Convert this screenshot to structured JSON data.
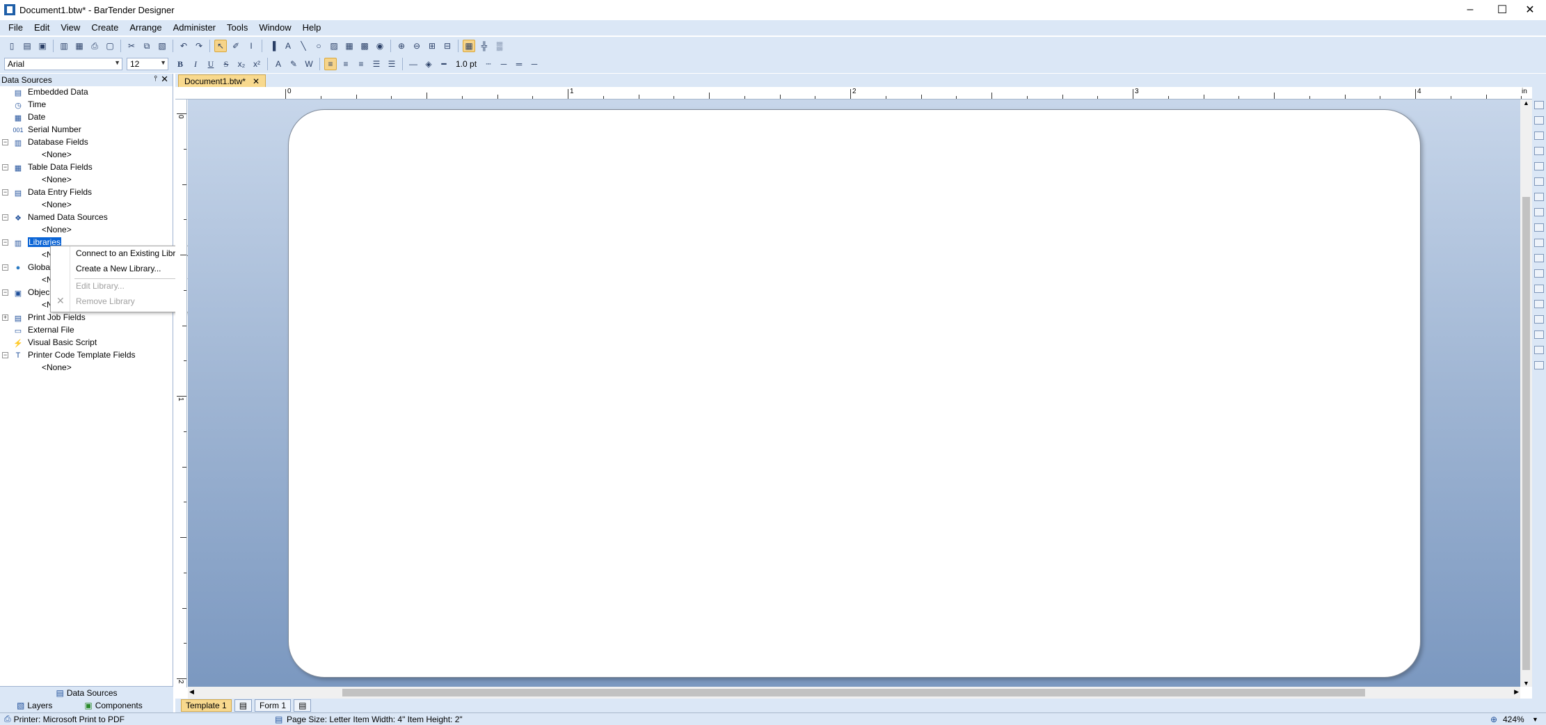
{
  "window": {
    "title": "Document1.btw* - BarTender Designer",
    "controls": [
      "minimize",
      "maximize",
      "close"
    ]
  },
  "menubar": [
    "File",
    "Edit",
    "View",
    "Create",
    "Arrange",
    "Administer",
    "Tools",
    "Window",
    "Help"
  ],
  "format_toolbar": {
    "font": "Arial",
    "size": "12",
    "bold": "B",
    "italic": "I",
    "underline": "U",
    "strike": "S",
    "subscript": "x₂",
    "superscript": "x²",
    "line_width": "1.0 pt"
  },
  "data_sources_panel": {
    "title": "Data Sources",
    "items": [
      {
        "label": "Embedded Data",
        "icon": "embedded-data-icon",
        "glyph": "▤",
        "expander": ""
      },
      {
        "label": "Time",
        "icon": "clock-icon",
        "glyph": "◷",
        "expander": ""
      },
      {
        "label": "Date",
        "icon": "calendar-icon",
        "glyph": "▦",
        "expander": ""
      },
      {
        "label": "Serial Number",
        "icon": "serial-number-icon",
        "glyph": "001",
        "expander": ""
      },
      {
        "label": "Database Fields",
        "icon": "database-icon",
        "glyph": "▥",
        "expander": "−",
        "child": "<None>"
      },
      {
        "label": "Table Data Fields",
        "icon": "table-icon",
        "glyph": "▦",
        "expander": "−",
        "child": "<None>"
      },
      {
        "label": "Data Entry Fields",
        "icon": "form-icon",
        "glyph": "▤",
        "expander": "−",
        "child": "<None>"
      },
      {
        "label": "Named Data Sources",
        "icon": "named-data-icon",
        "glyph": "❖",
        "expander": "−",
        "child": "<None>"
      },
      {
        "label": "Libraries",
        "icon": "library-icon",
        "glyph": "▥",
        "expander": "−",
        "child": "<N",
        "selected": true
      },
      {
        "label": "Globa",
        "icon": "globe-icon",
        "glyph": "●",
        "expander": "−",
        "child": "<N"
      },
      {
        "label": "Objec",
        "icon": "object-icon",
        "glyph": "▣",
        "expander": "−",
        "child": "<N"
      },
      {
        "label": "Print Job Fields",
        "icon": "print-job-icon",
        "glyph": "▤",
        "expander": "+"
      },
      {
        "label": "External File",
        "icon": "external-file-icon",
        "glyph": "▭",
        "expander": ""
      },
      {
        "label": "Visual Basic Script",
        "icon": "script-icon",
        "glyph": "⚡",
        "expander": ""
      },
      {
        "label": "Printer Code Template Fields",
        "icon": "template-field-icon",
        "glyph": "T",
        "expander": "−",
        "child": "<None>"
      }
    ],
    "bottom_tab": "Data Sources",
    "bottom_tabs": [
      "Layers",
      "Components"
    ]
  },
  "context_menu": {
    "items": [
      {
        "label": "Connect to an Existing Library...",
        "enabled": true
      },
      {
        "label": "Create a New Library...",
        "enabled": true
      },
      {
        "label": "Edit Library...",
        "enabled": false
      },
      {
        "label": "Remove Library",
        "enabled": false
      }
    ]
  },
  "document": {
    "tab_label": "Document1.btw*",
    "ruler_h": [
      "0",
      "1",
      "2",
      "3",
      "4"
    ],
    "ruler_h_unit": "in",
    "ruler_v": [
      "0",
      "1",
      "2"
    ],
    "template_tabs": [
      "Template 1",
      "Form 1"
    ]
  },
  "statusbar": {
    "printer": "Printer: Microsoft Print to PDF",
    "page_info": "Page Size: Letter  Item Width: 4\"  Item Height: 2\"",
    "zoom": "424%"
  },
  "colors": {
    "chrome": "#dbe7f6",
    "selection": "#0a64d6",
    "active_tab": "#f8d98e",
    "annotation_arrow": "#2ea84a"
  }
}
